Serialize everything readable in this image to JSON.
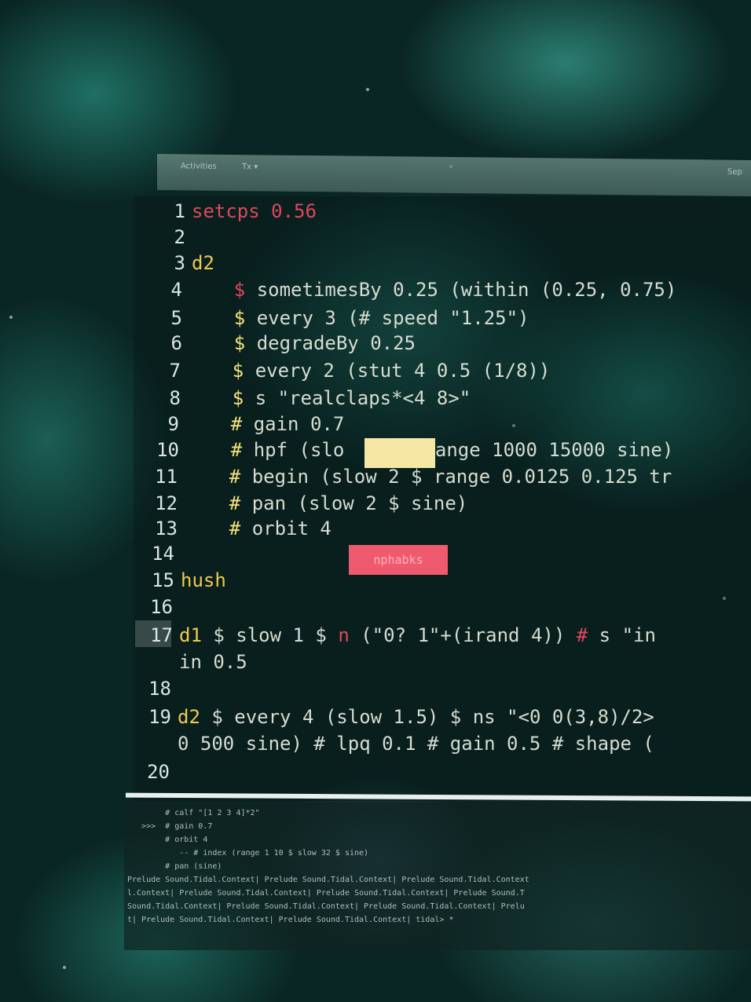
{
  "app": {
    "menu": [
      "Activities",
      "Tx ▾"
    ],
    "menu_right": "Sep"
  },
  "editor": {
    "lines": [
      {
        "n": "1",
        "segments": [
          {
            "t": "setcps 0.56",
            "c": "red"
          }
        ]
      },
      {
        "n": "2",
        "segments": []
      },
      {
        "n": "3",
        "segments": [
          {
            "t": "d2",
            "c": "yel"
          }
        ]
      },
      {
        "n": "4",
        "segments": [
          {
            "t": "    $ ",
            "c": "red"
          },
          {
            "t": "sometimesBy 0.25 (within (0.25, 0.75)",
            "c": "plain"
          }
        ]
      },
      {
        "n": "5",
        "segments": [
          {
            "t": "    $ ",
            "c": "op"
          },
          {
            "t": "every 3 (# speed \"1.25\")",
            "c": "plain"
          }
        ]
      },
      {
        "n": "6",
        "segments": [
          {
            "t": "    $ ",
            "c": "op"
          },
          {
            "t": "degradeBy 0.25",
            "c": "plain"
          }
        ]
      },
      {
        "n": "7",
        "segments": [
          {
            "t": "    $ ",
            "c": "op"
          },
          {
            "t": "every 2 (stut 4 0.5 (1/8))",
            "c": "plain"
          }
        ]
      },
      {
        "n": "8",
        "segments": [
          {
            "t": "    $ ",
            "c": "op"
          },
          {
            "t": "s \"realclaps*<4 8>\"",
            "c": "plain"
          }
        ]
      },
      {
        "n": "9",
        "segments": [
          {
            "t": "    # ",
            "c": "op"
          },
          {
            "t": "gain 0.7",
            "c": "plain"
          }
        ]
      },
      {
        "n": "10",
        "segments": [
          {
            "t": "    # ",
            "c": "op"
          },
          {
            "t": "hpf (slo       range 1000 15000 sine)",
            "c": "plain"
          }
        ]
      },
      {
        "n": "11",
        "segments": [
          {
            "t": "    # ",
            "c": "op"
          },
          {
            "t": "begin (slow 2 $ range 0.0125 0.125 tr",
            "c": "plain"
          }
        ]
      },
      {
        "n": "12",
        "segments": [
          {
            "t": "    # ",
            "c": "op"
          },
          {
            "t": "pan (slow 2 $ sine)",
            "c": "plain"
          }
        ]
      },
      {
        "n": "13",
        "segments": [
          {
            "t": "    # ",
            "c": "op"
          },
          {
            "t": "orbit 4",
            "c": "plain"
          }
        ]
      },
      {
        "n": "14",
        "segments": []
      },
      {
        "n": "15",
        "segments": [
          {
            "t": "hush",
            "c": "yel"
          }
        ]
      },
      {
        "n": "16",
        "segments": []
      },
      {
        "n": "17",
        "segments": [
          {
            "t": "d1 ",
            "c": "yel"
          },
          {
            "t": "$ slow 1 $ ",
            "c": "plain"
          },
          {
            "t": "n ",
            "c": "red"
          },
          {
            "t": "(\"0? 1\"+(irand 4)) ",
            "c": "plain"
          },
          {
            "t": "# ",
            "c": "red"
          },
          {
            "t": "s \"in",
            "c": "plain"
          }
        ]
      },
      {
        "n": "",
        "segments": [
          {
            "t": "in 0.5",
            "c": "plain"
          }
        ]
      },
      {
        "n": "18",
        "segments": []
      },
      {
        "n": "19",
        "segments": [
          {
            "t": "d2 ",
            "c": "yel"
          },
          {
            "t": "$ every 4 (slow 1.5) $ ns \"<0 0(3,8)/2>",
            "c": "plain"
          }
        ]
      },
      {
        "n": "",
        "segments": [
          {
            "t": "0 500 sine) # lpq 0.1 # gain 0.5 # shape (",
            "c": "plain"
          }
        ]
      },
      {
        "n": "20",
        "segments": []
      }
    ],
    "tooltip_red_text": "nphabks"
  },
  "console": {
    "lines": [
      "        # calf \"[1 2 3 4]*2\"",
      "   >>>  # gain 0.7",
      "        # orbit 4",
      "           -- # index (range 1 10 $ slow 32 $ sine)",
      "        # pan (sine)",
      "Prelude Sound.Tidal.Context| Prelude Sound.Tidal.Context| Prelude Sound.Tidal.Context",
      "l.Context| Prelude Sound.Tidal.Context| Prelude Sound.Tidal.Context| Prelude Sound.T",
      "Sound.Tidal.Context| Prelude Sound.Tidal.Context| Prelude Sound.Tidal.Context| Prelu",
      "t| Prelude Sound.Tidal.Context| Prelude Sound.Tidal.Context| tidal> *"
    ]
  },
  "colors": {
    "keyword_red": "#e0475a",
    "keyword_yellow": "#f1c94f",
    "code_text": "#d6dccf",
    "background": "#0a2624"
  }
}
